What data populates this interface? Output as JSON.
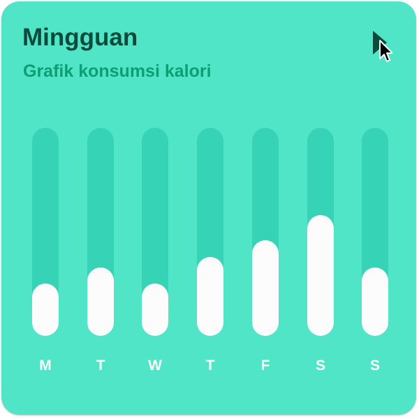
{
  "card": {
    "title": "Mingguan",
    "subtitle": "Grafik konsumsi kalori"
  },
  "icons": {
    "play": "play-icon",
    "cursor": "mouse-pointer-icon"
  },
  "colors": {
    "card_background": "#51e5c8",
    "track": "#37d3b7",
    "fill": "#fcfcfc",
    "title": "#0b4b3c",
    "subtitle": "#0e9e72",
    "day_label": "#ffffff"
  },
  "chart_data": {
    "type": "bar",
    "categories": [
      "M",
      "T",
      "W",
      "T",
      "F",
      "S",
      "S"
    ],
    "values": [
      0.25,
      0.33,
      0.25,
      0.38,
      0.46,
      0.58,
      0.33
    ],
    "value_unit": "fraction of track filled",
    "ylim": [
      0,
      1
    ]
  }
}
